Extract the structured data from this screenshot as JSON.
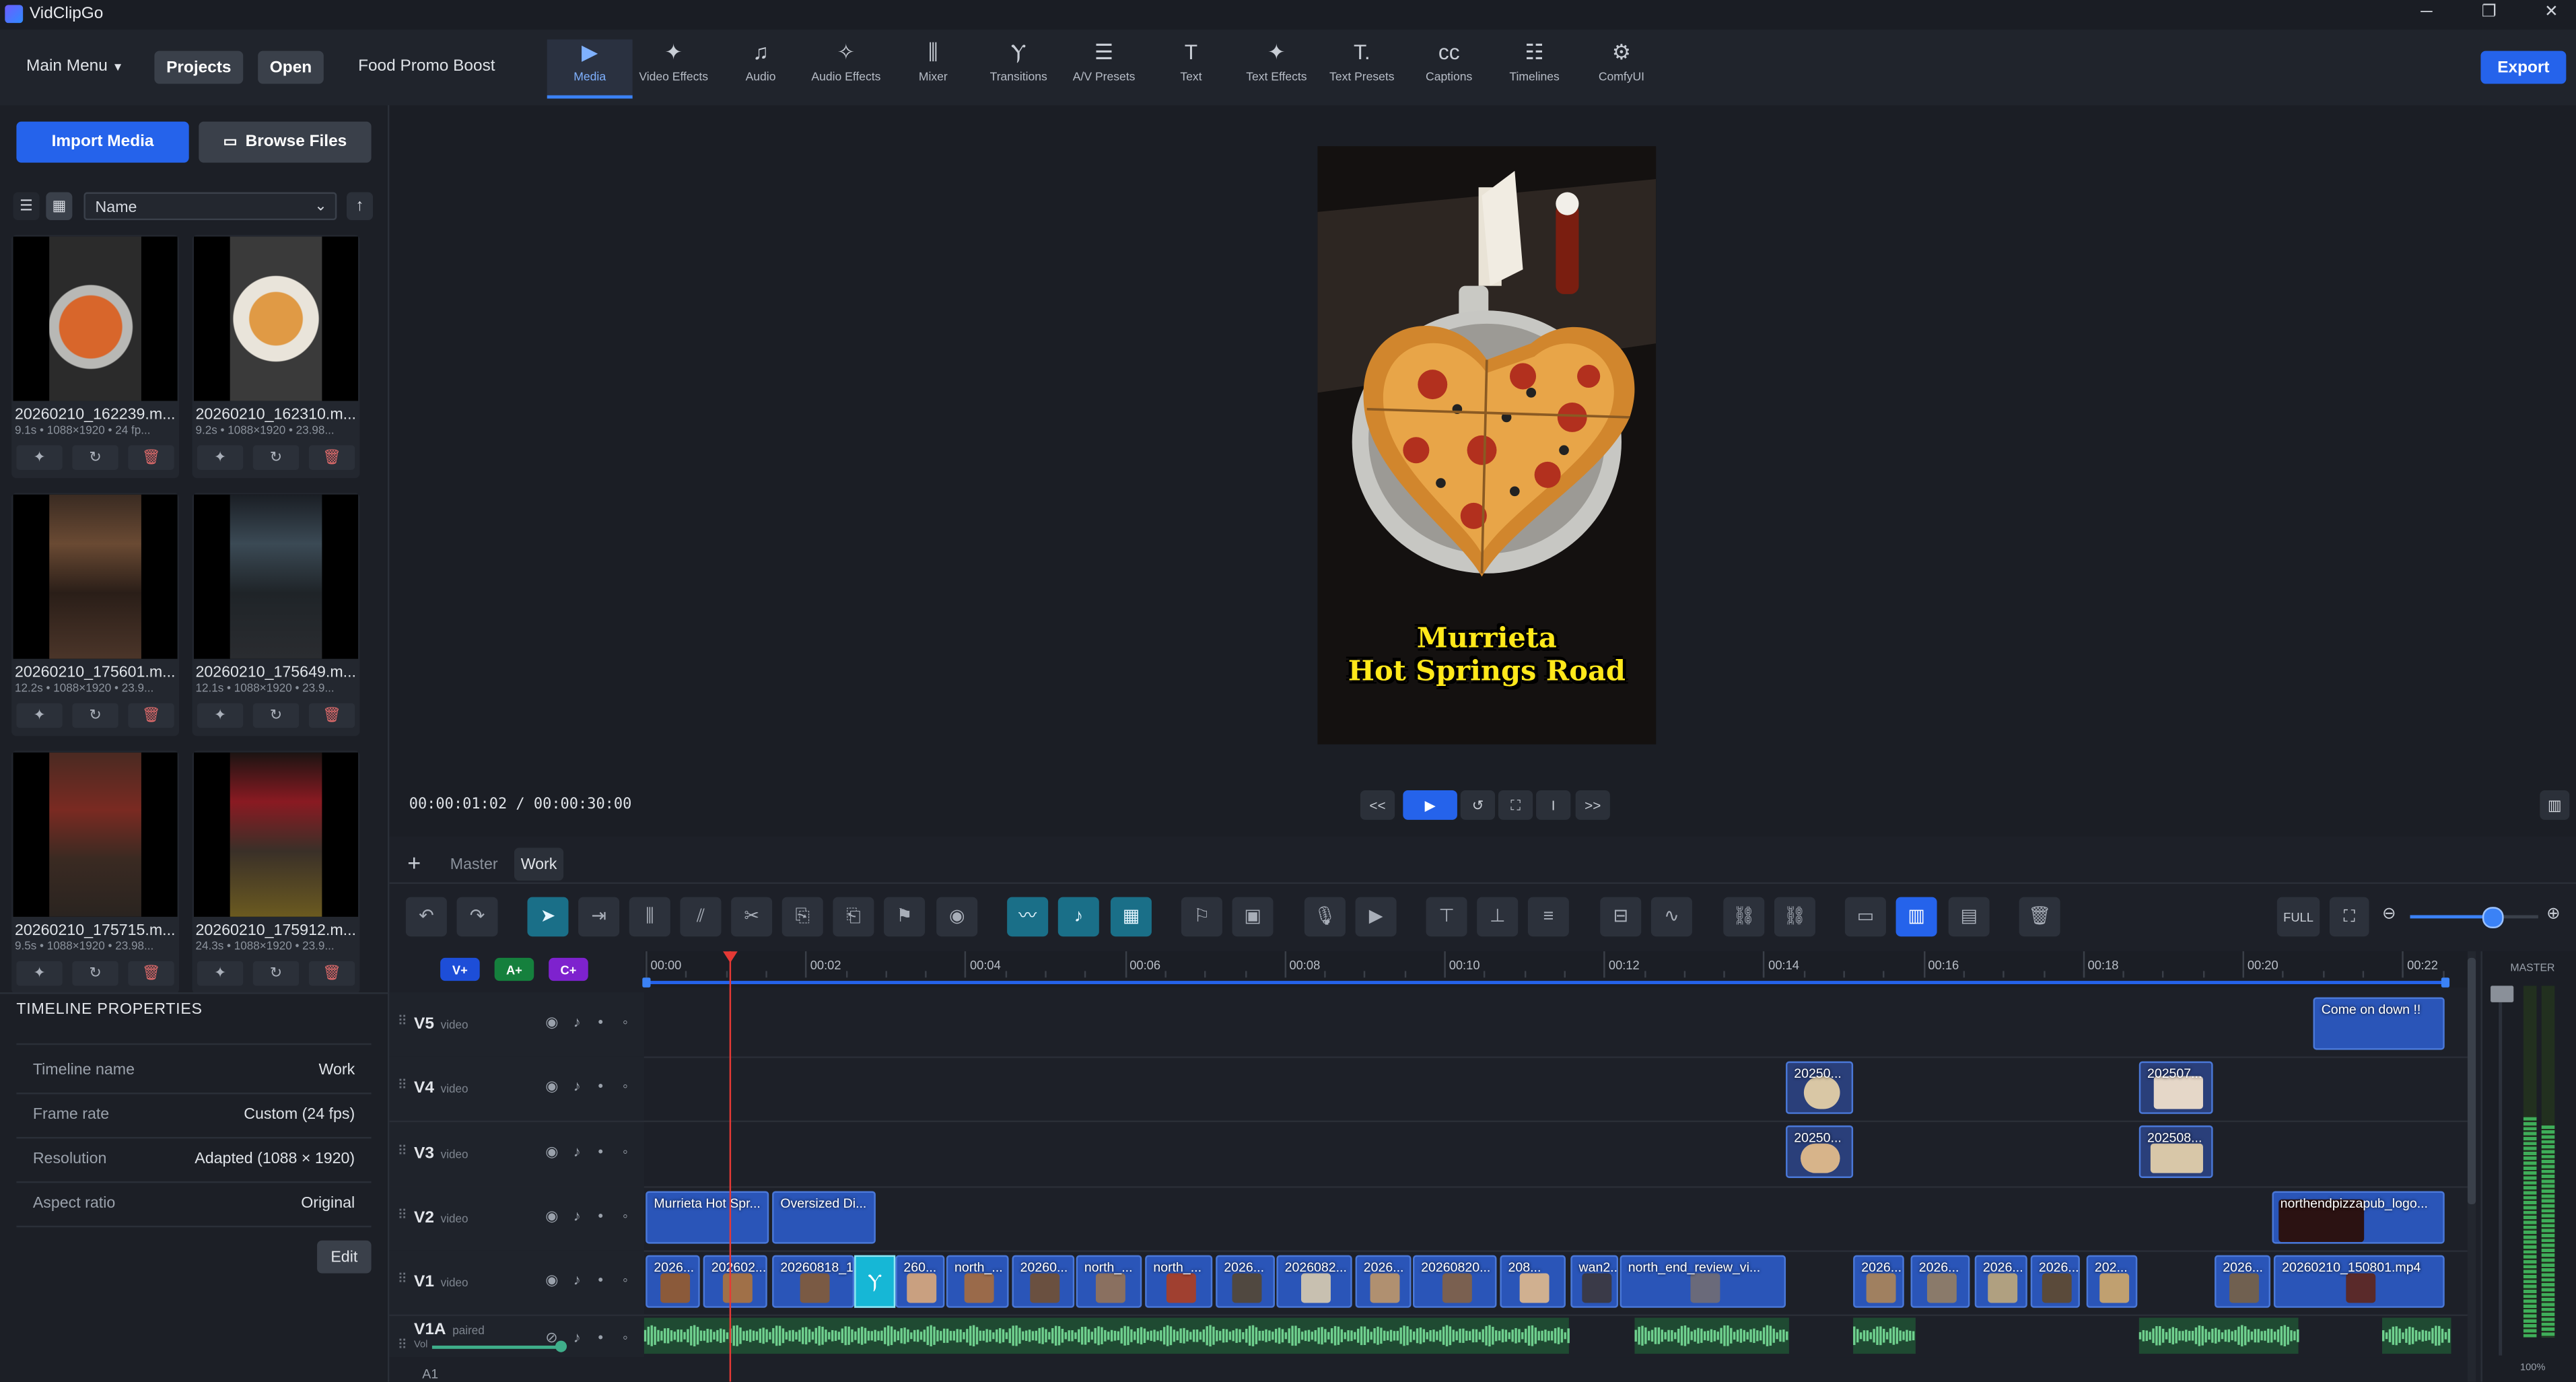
{
  "app": {
    "title": "VidClipGo"
  },
  "window": {
    "minimize": "─",
    "maximize": "❐",
    "close": "✕"
  },
  "header": {
    "main_menu": "Main Menu",
    "projects": "Projects",
    "open": "Open",
    "project_name": "Food Promo Boost",
    "export": "Export",
    "tools": [
      {
        "label": "Media",
        "icon": "▶"
      },
      {
        "label": "Video Effects",
        "icon": "✦"
      },
      {
        "label": "Audio",
        "icon": "♫"
      },
      {
        "label": "Audio Effects",
        "icon": "✧"
      },
      {
        "label": "Mixer",
        "icon": "⫼"
      },
      {
        "label": "Transitions",
        "icon": "Ⲩ"
      },
      {
        "label": "A/V Presets",
        "icon": "☰"
      },
      {
        "label": "Text",
        "icon": "T"
      },
      {
        "label": "Text Effects",
        "icon": "✦"
      },
      {
        "label": "Text Presets",
        "icon": "T."
      },
      {
        "label": "Captions",
        "icon": "cc"
      },
      {
        "label": "Timelines",
        "icon": "☷"
      },
      {
        "label": "ComfyUI",
        "icon": "⚙"
      }
    ]
  },
  "media": {
    "import": "Import Media",
    "browse": "Browse Files",
    "sort": "Name",
    "items": [
      {
        "name": "20260210_162239.m...",
        "meta": "9.1s • 1088×1920 • 24 fp..."
      },
      {
        "name": "20260210_162310.m...",
        "meta": "9.2s • 1088×1920 • 23.98..."
      },
      {
        "name": "20260210_175601.m...",
        "meta": "12.2s • 1088×1920 • 23.9..."
      },
      {
        "name": "20260210_175649.m...",
        "meta": "12.1s • 1088×1920 • 23.9..."
      },
      {
        "name": "20260210_175715.m...",
        "meta": "9.5s • 1088×1920 • 23.98..."
      },
      {
        "name": "20260210_175912.m...",
        "meta": "24.3s • 1088×1920 • 23.9..."
      }
    ]
  },
  "timeline_props": {
    "heading": "TIMELINE PROPERTIES",
    "rows": [
      {
        "k": "Timeline name",
        "v": "Work"
      },
      {
        "k": "Frame rate",
        "v": "Custom (24 fps)"
      },
      {
        "k": "Resolution",
        "v": "Adapted (1088 × 1920)"
      },
      {
        "k": "Aspect ratio",
        "v": "Original"
      }
    ],
    "edit": "Edit"
  },
  "preview": {
    "caption_line1": "Murrieta",
    "caption_line2": "Hot Springs Road",
    "timecode": "00:00:01:02 / 00:00:30:00",
    "controls": [
      "<<",
      "▶",
      "↺",
      "⛶",
      "I",
      ">>"
    ]
  },
  "timeline": {
    "tabs": {
      "add": "+",
      "master": "Master",
      "work": "Work"
    },
    "add_v": "V+",
    "add_a": "A+",
    "add_c": "C+",
    "full": "FULL",
    "master_label": "MASTER",
    "master_pct": "100%",
    "ruler": [
      "00:00",
      "00:02",
      "00:04",
      "00:06",
      "00:08",
      "00:10",
      "00:12",
      "00:14",
      "00:16",
      "00:18",
      "00:20",
      "00:22"
    ],
    "tracks": [
      {
        "name": "V5",
        "type": "video"
      },
      {
        "name": "V4",
        "type": "video"
      },
      {
        "name": "V3",
        "type": "video"
      },
      {
        "name": "V2",
        "type": "video"
      },
      {
        "name": "V1",
        "type": "video"
      },
      {
        "name": "V1A",
        "type": "paired"
      }
    ],
    "vol_label": "Vol",
    "clips": {
      "v5_text": "Come on down !!",
      "v4_a": "20250...",
      "v4_b": "202507...",
      "v3_a": "20250...",
      "v3_b": "202508...",
      "v2_a": "Murrieta Hot Spr...",
      "v2_b": "Oversized Di...",
      "v2_c": "northendpizzapub_logo...",
      "v1": [
        "2026...",
        "202602...",
        "20260818_12...",
        "260...",
        "north_...",
        "20260...",
        "north_...",
        "north_...",
        "2026...",
        "2026082...",
        "2026...",
        "20260820...",
        "208...",
        "wan2...",
        "north_end_review_vi...",
        "2026...",
        "2026...",
        "2026...",
        "2026...",
        "202...",
        "2026...",
        "20260210_150801.mp4"
      ]
    }
  },
  "colors": {
    "accent": "#2563eb",
    "playhead": "#e53935",
    "clip": "#2a55b8",
    "teal": "#1a6f88",
    "audio": "#4fae6a"
  }
}
